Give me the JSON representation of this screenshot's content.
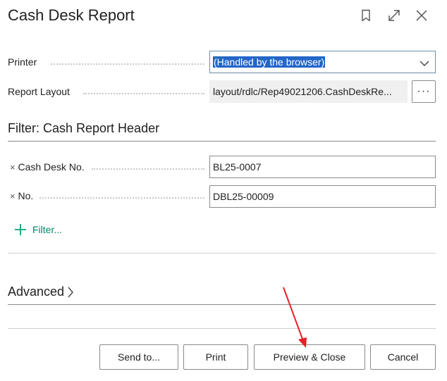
{
  "dialog": {
    "title": "Cash Desk Report",
    "icons": [
      "bookmark-icon",
      "expand-icon",
      "close-icon"
    ]
  },
  "options": {
    "printer_label": "Printer",
    "printer_value": "(Handled by the browser)",
    "report_layout_label": "Report Layout",
    "report_layout_value": "layout/rdlc/Rep49021206.CashDeskRe...",
    "assist_label": "···"
  },
  "filter": {
    "title": "Filter: Cash Report Header",
    "rows": [
      {
        "label": "Cash Desk No.",
        "value": "BL25-0007"
      },
      {
        "label": "No.",
        "value": "DBL25-00009"
      }
    ],
    "remove_glyph": "×",
    "add_label": "Filter..."
  },
  "advanced": {
    "label": "Advanced"
  },
  "buttons": {
    "send_to": "Send to...",
    "print": "Print",
    "preview_close": "Preview & Close",
    "cancel": "Cancel"
  },
  "colors": {
    "accent": "#00a37a",
    "selection": "#2465c8",
    "annotation_arrow": "#e8202a"
  }
}
